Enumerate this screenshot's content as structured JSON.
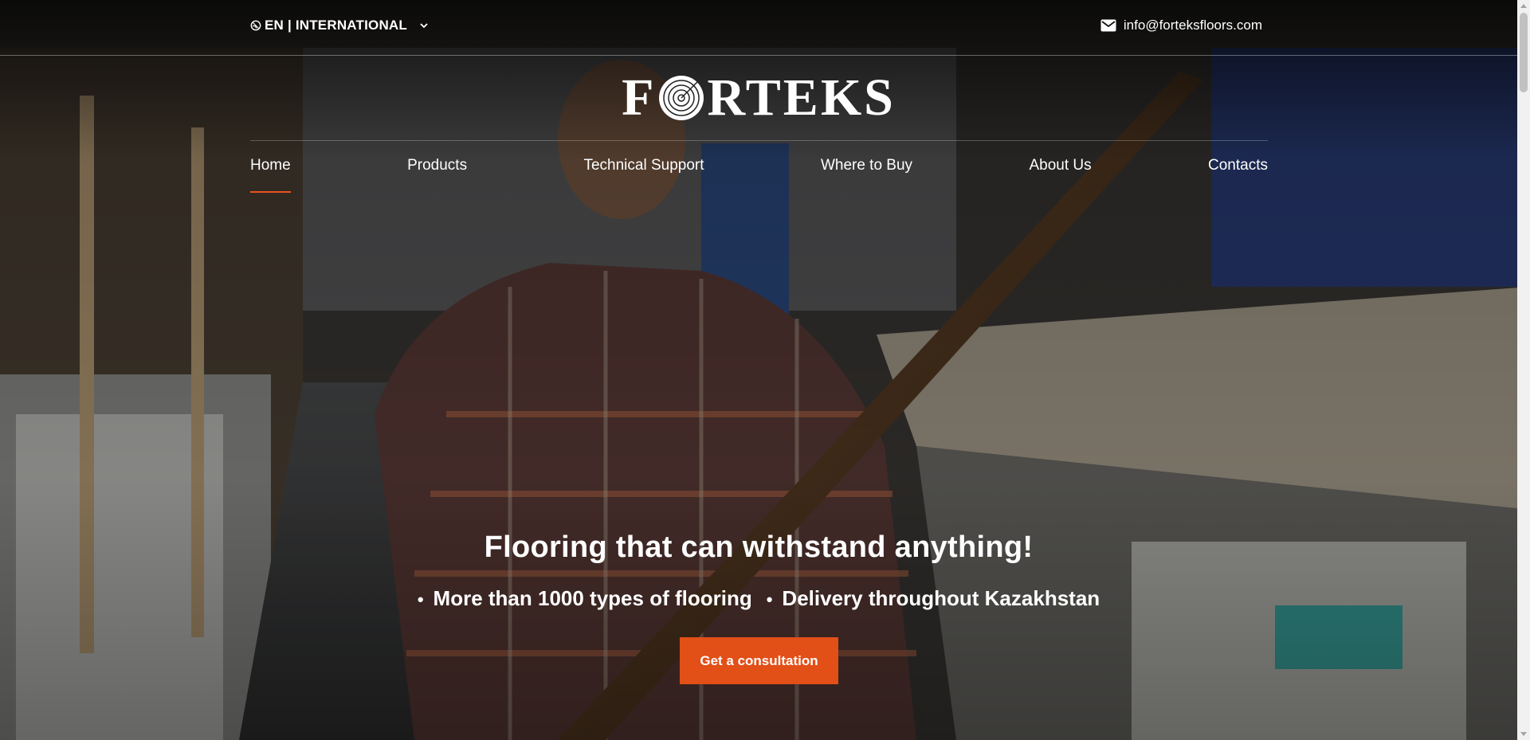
{
  "topbar": {
    "language_label": "EN | INTERNATIONAL",
    "email": "info@forteksfloors.com"
  },
  "brand": {
    "logo_left": "F",
    "logo_right": "RTEKS"
  },
  "nav": {
    "items": [
      {
        "label": "Home",
        "active": true
      },
      {
        "label": "Products"
      },
      {
        "label": "Technical Support"
      },
      {
        "label": "Where to Buy"
      },
      {
        "label": "About Us"
      },
      {
        "label": "Contacts"
      }
    ]
  },
  "hero": {
    "title": "Flooring that can withstand anything!",
    "bullets": [
      "More than 1000 types of flooring",
      "Delivery throughout Kazakhstan"
    ],
    "cta_label": "Get a consultation"
  },
  "colors": {
    "accent": "#e24f17",
    "text": "#ffffff",
    "topbar_bg": "#000000"
  },
  "icons": {
    "language": "globe-icon",
    "language_dropdown": "chevron-down-icon",
    "email": "mail-icon",
    "logo_mark": "tree-ring-icon"
  }
}
